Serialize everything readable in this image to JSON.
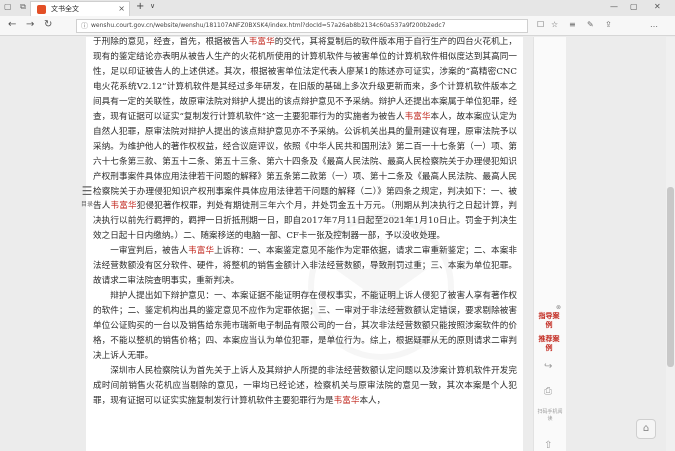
{
  "browser": {
    "tab_icons": "▢ ⧉",
    "tab_title": "文书全文",
    "tab_close": "×",
    "new_tab": "+",
    "tab_menu": "∨",
    "win_min": "—",
    "win_max": "▢",
    "win_close": "✕",
    "back": "←",
    "forward": "→",
    "reload": "↻",
    "lock": "ⓘ",
    "url": "wenshu.court.gov.cn/website/wenshu/181107ANFZ0BXSK4/index.html?docId=57a26ab8b2134c60a537a9f200b2edc7",
    "tools": [
      "☐",
      "☆",
      "≡",
      "✎",
      "⇪",
      "…"
    ]
  },
  "document": {
    "line0": "于刑除的意见，经查，首先，根据被告人",
    "name": "韦富华",
    "paragraphs": [
      {
        "pre": "于刑除的意见，经查，首先，根据被告人",
        "hl": "韦富华",
        "post": "的交代，其将复制后的软件版本用于自行生产的四台火花机上，现有的鉴定结论亦表明从被告人生产的火花机所使用的计算机软件与被害单位的计算机软件相似度达到其高同一性，足以印证被告人的上述供述。其次，根据被害单位法定代表人廖某1的陈述亦可证实，涉案的“高精密CNC电火花系统V2.12”计算机软件是其经过多年研发，在旧版的基础上多次升级更新而来，多个计算机软件版本之间具有一定的关联性，故原审法院对辩护人提出的该点辩护意见不予采纳。辩护人还提出本案属于单位犯罪，经查，现有证据可以证实“复制发行计算机软件”这一主要犯罪行为的实施者为被告人",
        "hl2": "韦富华",
        "post2": "本人，故本案应认定为自然人犯罪，原审法院对辩护人提出的该点辩护意见亦不予采纳。公诉机关出具的量刑建议有理，原审法院予以采纳。为维护他人的著作权权益，经合议庭评议，依照《中华人民共和国刑法》第二百一十七条第（一）项、第六十七条第三款、第五十二条、第五十三条、第六十四条及《最高人民法院、最高人民检察院关于办理侵犯知识产权刑事案件具体应用法律若干问题的解释》第五条第二款第（一）项、第十二条及《最高人民法院、最高人民检察院关于办理侵犯知识产权刑事案件具体应用法律若干问题的解释（二）》第四条之规定，判决如下：一、被告人",
        "hl3": "韦富华",
        "post3": "犯侵犯著作权罪，判处有期徒刑三年六个月，并处罚金五十万元。（刑期从判决执行之日起计算，判决执行以前先行羁押的，羁押一日折抵刑期一日，即自2017年7月11日起至2021年1月10日止。罚金于判决生效之日起十日内缴纳。）二、随案移送的电脑一部、CF卡一张及控制器一部，予以没收处理。"
      },
      {
        "pre": "一审宣判后，被告人",
        "hl": "韦富华",
        "post": "上诉称：一、本案鉴定意见不能作为定罪依据，请求二审重新鉴定；二、本案非法经营数额没有区分软件、硬件，将整机的销售金额计入非法经营数额，导致刑罚过重；三、本案为单位犯罪。故请求二审法院查明事实，重新判决。"
      },
      {
        "pre": "辩护人提出如下辩护意见：一、本案证据不能证明存在侵权事实，不能证明上诉人侵犯了被害人享有著作权的软件；二、鉴定机构出具的鉴定意见不应作为定罪依据；三、一审对于非法经营数额认定错误，要求剔除被害单位公证购买的一台以及销售给东莞市瑞新电子制品有限公司的一台，其次非法经营数额只能按照涉案软件的价格，不能以整机的销售价格；四、本案应当认为单位犯罪，是单位行为。综上，根据疑罪从无的原则请求二审判决上诉人无罪。"
      },
      {
        "pre": "深圳市人民检察院认为首先关于上诉人及其辩护人所提的非法经营数额认定问题以及涉案计算机软件开发完成时间前销售火花机应当剔除的意见，一审均已经论述，检察机关与原审法院的意见一致，其次本案是个人犯罪，现有证据可以证实实施复制发行计算机软件主要犯罪行为是",
        "hl": "韦富华",
        "post": "本人，"
      }
    ]
  },
  "toc": {
    "icon": "☰",
    "label": "目录"
  },
  "sidebar": {
    "close": "⊗",
    "link1": "指导案例",
    "link2": "推荐案例",
    "share_icon": "↪",
    "print_icon": "⎙",
    "scan_label": "扫码手机阅读",
    "up_icon": "⇧"
  },
  "float_button": "⌂"
}
